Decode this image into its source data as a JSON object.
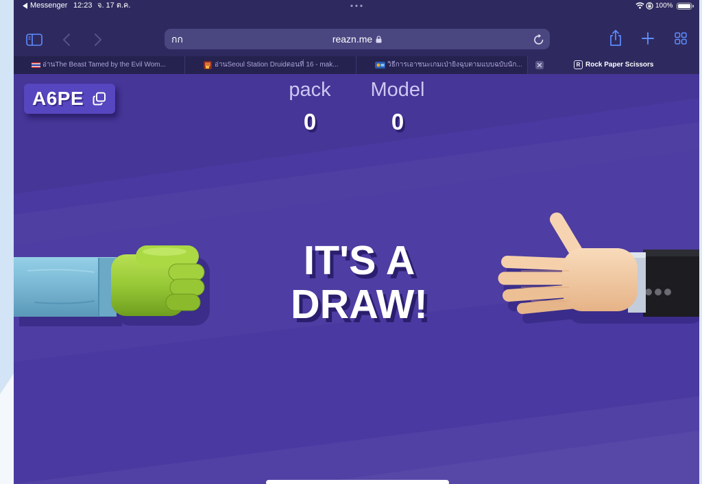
{
  "status_bar": {
    "back_app": "Messenger",
    "time": "12:23",
    "date": "จ. 17 ต.ค.",
    "battery_percent": "100%",
    "battery_level": 1.0
  },
  "toolbar": {
    "reader_label": "กก",
    "url": "reazn.me"
  },
  "tabs": [
    {
      "title": "อ่านThe Beast Tamed by the Evil Wom...",
      "active": false
    },
    {
      "title": "อ่านSeoul Station Druidตอนที่ 16 - mak...",
      "active": false
    },
    {
      "title": "วิธีการเอาชนะเกมเป่ายิงฉุบตามแบบฉบับนัก...",
      "active": false
    },
    {
      "title": "Rock Paper Scissors",
      "favicon_letter": "R",
      "active": true
    }
  ],
  "game": {
    "room_code": "A6PE",
    "scores": [
      {
        "label": "pack",
        "value": "0"
      },
      {
        "label": "Model",
        "value": "0"
      }
    ],
    "result": [
      "IT'S A",
      "DRAW!"
    ]
  },
  "icons": {
    "status_back": "back-to-app-icon",
    "multitask": "multitasking-dots-icon",
    "wifi": "wifi-icon",
    "rotation_lock": "rotation-lock-icon",
    "battery": "battery-icon",
    "sidebar": "sidebar-icon",
    "back": "chevron-left-icon",
    "forward": "chevron-right-icon",
    "lock": "lock-icon",
    "reload": "reload-icon",
    "share": "share-icon",
    "new_tab": "plus-icon",
    "tab_overview": "tab-grid-icon",
    "close_tab": "close-tab-icon",
    "copy": "copy-icon",
    "player_hand": "rock-fist-icon",
    "opponent_hand": "paper-hand-icon"
  },
  "colors": {
    "chrome_bg": "#2e2a5f",
    "tabbar_bg": "#26224f",
    "accent_blue": "#5f8dff",
    "game_bg": "#4a39a0",
    "room_code_bg": "#5646bf",
    "text_shadow": "#2a1e6e",
    "player_sleeve": "#7ab7d3",
    "player_fist": "#9acb38",
    "opponent_skin": "#f2c9a1",
    "opponent_sleeve": "#1c1c21"
  }
}
